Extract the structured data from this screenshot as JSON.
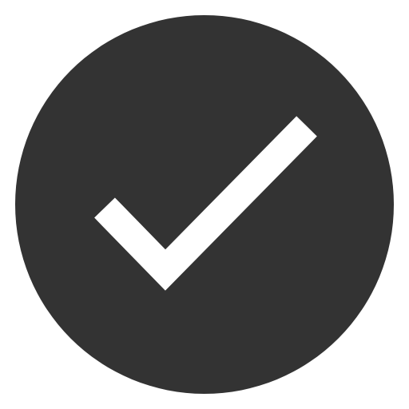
{
  "icon": {
    "name": "check-circle-icon",
    "circle_color": "#333333",
    "check_color": "#ffffff",
    "background_color": "#ffffff"
  }
}
